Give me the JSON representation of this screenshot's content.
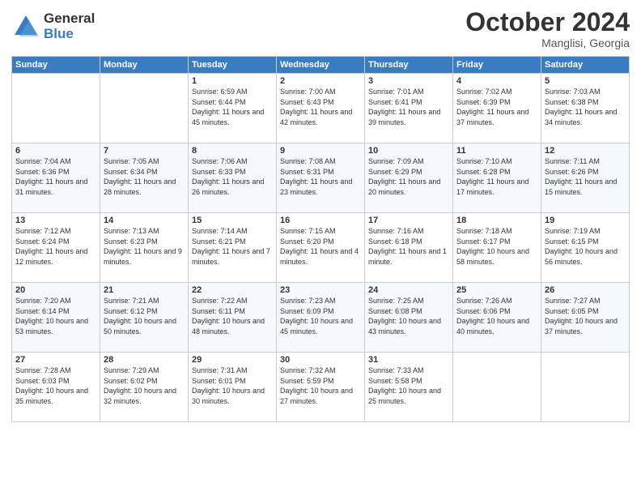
{
  "logo": {
    "general": "General",
    "blue": "Blue"
  },
  "title": "October 2024",
  "subtitle": "Manglisi, Georgia",
  "weekdays": [
    "Sunday",
    "Monday",
    "Tuesday",
    "Wednesday",
    "Thursday",
    "Friday",
    "Saturday"
  ],
  "rows": [
    [
      null,
      null,
      {
        "day": "1",
        "sunrise": "Sunrise: 6:59 AM",
        "sunset": "Sunset: 6:44 PM",
        "daylight": "Daylight: 11 hours and 45 minutes."
      },
      {
        "day": "2",
        "sunrise": "Sunrise: 7:00 AM",
        "sunset": "Sunset: 6:43 PM",
        "daylight": "Daylight: 11 hours and 42 minutes."
      },
      {
        "day": "3",
        "sunrise": "Sunrise: 7:01 AM",
        "sunset": "Sunset: 6:41 PM",
        "daylight": "Daylight: 11 hours and 39 minutes."
      },
      {
        "day": "4",
        "sunrise": "Sunrise: 7:02 AM",
        "sunset": "Sunset: 6:39 PM",
        "daylight": "Daylight: 11 hours and 37 minutes."
      },
      {
        "day": "5",
        "sunrise": "Sunrise: 7:03 AM",
        "sunset": "Sunset: 6:38 PM",
        "daylight": "Daylight: 11 hours and 34 minutes."
      }
    ],
    [
      {
        "day": "6",
        "sunrise": "Sunrise: 7:04 AM",
        "sunset": "Sunset: 6:36 PM",
        "daylight": "Daylight: 11 hours and 31 minutes."
      },
      {
        "day": "7",
        "sunrise": "Sunrise: 7:05 AM",
        "sunset": "Sunset: 6:34 PM",
        "daylight": "Daylight: 11 hours and 28 minutes."
      },
      {
        "day": "8",
        "sunrise": "Sunrise: 7:06 AM",
        "sunset": "Sunset: 6:33 PM",
        "daylight": "Daylight: 11 hours and 26 minutes."
      },
      {
        "day": "9",
        "sunrise": "Sunrise: 7:08 AM",
        "sunset": "Sunset: 6:31 PM",
        "daylight": "Daylight: 11 hours and 23 minutes."
      },
      {
        "day": "10",
        "sunrise": "Sunrise: 7:09 AM",
        "sunset": "Sunset: 6:29 PM",
        "daylight": "Daylight: 11 hours and 20 minutes."
      },
      {
        "day": "11",
        "sunrise": "Sunrise: 7:10 AM",
        "sunset": "Sunset: 6:28 PM",
        "daylight": "Daylight: 11 hours and 17 minutes."
      },
      {
        "day": "12",
        "sunrise": "Sunrise: 7:11 AM",
        "sunset": "Sunset: 6:26 PM",
        "daylight": "Daylight: 11 hours and 15 minutes."
      }
    ],
    [
      {
        "day": "13",
        "sunrise": "Sunrise: 7:12 AM",
        "sunset": "Sunset: 6:24 PM",
        "daylight": "Daylight: 11 hours and 12 minutes."
      },
      {
        "day": "14",
        "sunrise": "Sunrise: 7:13 AM",
        "sunset": "Sunset: 6:23 PM",
        "daylight": "Daylight: 11 hours and 9 minutes."
      },
      {
        "day": "15",
        "sunrise": "Sunrise: 7:14 AM",
        "sunset": "Sunset: 6:21 PM",
        "daylight": "Daylight: 11 hours and 7 minutes."
      },
      {
        "day": "16",
        "sunrise": "Sunrise: 7:15 AM",
        "sunset": "Sunset: 6:20 PM",
        "daylight": "Daylight: 11 hours and 4 minutes."
      },
      {
        "day": "17",
        "sunrise": "Sunrise: 7:16 AM",
        "sunset": "Sunset: 6:18 PM",
        "daylight": "Daylight: 11 hours and 1 minute."
      },
      {
        "day": "18",
        "sunrise": "Sunrise: 7:18 AM",
        "sunset": "Sunset: 6:17 PM",
        "daylight": "Daylight: 10 hours and 58 minutes."
      },
      {
        "day": "19",
        "sunrise": "Sunrise: 7:19 AM",
        "sunset": "Sunset: 6:15 PM",
        "daylight": "Daylight: 10 hours and 56 minutes."
      }
    ],
    [
      {
        "day": "20",
        "sunrise": "Sunrise: 7:20 AM",
        "sunset": "Sunset: 6:14 PM",
        "daylight": "Daylight: 10 hours and 53 minutes."
      },
      {
        "day": "21",
        "sunrise": "Sunrise: 7:21 AM",
        "sunset": "Sunset: 6:12 PM",
        "daylight": "Daylight: 10 hours and 50 minutes."
      },
      {
        "day": "22",
        "sunrise": "Sunrise: 7:22 AM",
        "sunset": "Sunset: 6:11 PM",
        "daylight": "Daylight: 10 hours and 48 minutes."
      },
      {
        "day": "23",
        "sunrise": "Sunrise: 7:23 AM",
        "sunset": "Sunset: 6:09 PM",
        "daylight": "Daylight: 10 hours and 45 minutes."
      },
      {
        "day": "24",
        "sunrise": "Sunrise: 7:25 AM",
        "sunset": "Sunset: 6:08 PM",
        "daylight": "Daylight: 10 hours and 43 minutes."
      },
      {
        "day": "25",
        "sunrise": "Sunrise: 7:26 AM",
        "sunset": "Sunset: 6:06 PM",
        "daylight": "Daylight: 10 hours and 40 minutes."
      },
      {
        "day": "26",
        "sunrise": "Sunrise: 7:27 AM",
        "sunset": "Sunset: 6:05 PM",
        "daylight": "Daylight: 10 hours and 37 minutes."
      }
    ],
    [
      {
        "day": "27",
        "sunrise": "Sunrise: 7:28 AM",
        "sunset": "Sunset: 6:03 PM",
        "daylight": "Daylight: 10 hours and 35 minutes."
      },
      {
        "day": "28",
        "sunrise": "Sunrise: 7:29 AM",
        "sunset": "Sunset: 6:02 PM",
        "daylight": "Daylight: 10 hours and 32 minutes."
      },
      {
        "day": "29",
        "sunrise": "Sunrise: 7:31 AM",
        "sunset": "Sunset: 6:01 PM",
        "daylight": "Daylight: 10 hours and 30 minutes."
      },
      {
        "day": "30",
        "sunrise": "Sunrise: 7:32 AM",
        "sunset": "Sunset: 5:59 PM",
        "daylight": "Daylight: 10 hours and 27 minutes."
      },
      {
        "day": "31",
        "sunrise": "Sunrise: 7:33 AM",
        "sunset": "Sunset: 5:58 PM",
        "daylight": "Daylight: 10 hours and 25 minutes."
      },
      null,
      null
    ]
  ]
}
